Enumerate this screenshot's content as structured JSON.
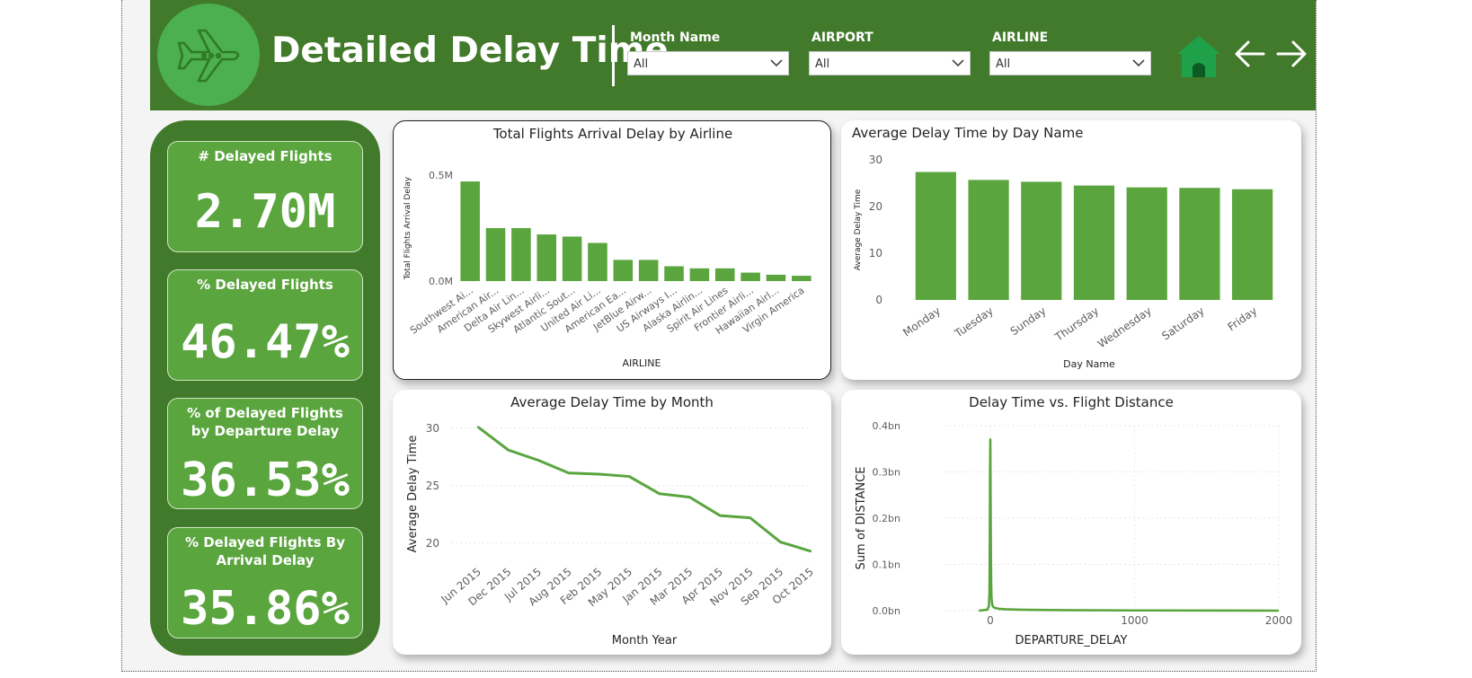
{
  "header": {
    "title": "Detailed Delay Time",
    "logo_icon": "airplane-icon",
    "filters": [
      {
        "label": "Month Name",
        "value": "All"
      },
      {
        "label": "AIRPORT",
        "value": "All"
      },
      {
        "label": "AIRLINE",
        "value": "All"
      }
    ],
    "nav_icons": [
      "home-icon",
      "arrow-left-icon",
      "arrow-right-icon"
    ]
  },
  "kpis": [
    {
      "label": "# Delayed Flights",
      "value": "2.70M"
    },
    {
      "label": "% Delayed Flights",
      "value": "46.47%"
    },
    {
      "label": "% of Delayed Flights by Departure Delay",
      "value": "36.53%"
    },
    {
      "label": "% Delayed Flights By Arrival Delay",
      "value": "35.86%"
    }
  ],
  "colors": {
    "header": "#427a2c",
    "bar": "#5aa53e",
    "accent": "#4caf50",
    "home": "#1fa14a"
  },
  "chart_data": [
    {
      "type": "bar",
      "title": "Total Flights Arrival Delay by Airline",
      "xlabel": "AIRLINE",
      "ylabel": "Total Flights Arrival Delay",
      "yticks": [
        "0.0M",
        "0.5M"
      ],
      "ylim": [
        0,
        0.5
      ],
      "categories": [
        "Southwest Ai...",
        "American Air...",
        "Delta Air Lin...",
        "Skywest Airli...",
        "Atlantic Sout...",
        "United Air Li...",
        "American Ea...",
        "JetBlue Airw...",
        "US Airways I...",
        "Alaska Airlin...",
        "Spirit Air Lines",
        "Frontier Airli...",
        "Hawaiian Airl...",
        "Virgin America"
      ],
      "values": [
        0.47,
        0.25,
        0.25,
        0.22,
        0.21,
        0.18,
        0.1,
        0.1,
        0.07,
        0.06,
        0.06,
        0.04,
        0.03,
        0.025
      ]
    },
    {
      "type": "bar",
      "title": "Average Delay Time by Day Name",
      "xlabel": "Day Name",
      "ylabel": "Average Delay Time",
      "yticks": [
        "0",
        "10",
        "20",
        "30"
      ],
      "ylim": [
        0,
        30
      ],
      "categories": [
        "Monday",
        "Tuesday",
        "Sunday",
        "Thursday",
        "Wednesday",
        "Saturday",
        "Friday"
      ],
      "values": [
        27.4,
        25.7,
        25.3,
        24.5,
        24.1,
        24.0,
        23.7
      ]
    },
    {
      "type": "line",
      "title": "Average Delay Time by Month",
      "xlabel": "Month Year",
      "ylabel": "Average Delay Time",
      "yticks": [
        "20",
        "25",
        "30"
      ],
      "ylim": [
        18.5,
        31
      ],
      "categories": [
        "Jun 2015",
        "Dec 2015",
        "Jul 2015",
        "Aug 2015",
        "Feb 2015",
        "May 2015",
        "Jan 2015",
        "Mar 2015",
        "Apr 2015",
        "Nov 2015",
        "Sep 2015",
        "Oct 2015"
      ],
      "values": [
        30.1,
        28.1,
        27.2,
        26.1,
        26.0,
        25.8,
        24.3,
        24.0,
        22.4,
        22.2,
        20.1,
        19.3
      ]
    },
    {
      "type": "line",
      "title": "Delay Time vs. Flight Distance",
      "xlabel": "DEPARTURE_DELAY",
      "ylabel": "Sum of DISTANCE",
      "xticks": [
        "0",
        "1000",
        "2000"
      ],
      "yticks": [
        "0.0bn",
        "0.1bn",
        "0.2bn",
        "0.3bn",
        "0.4bn"
      ],
      "xlim": [
        -80,
        2000
      ],
      "ylim": [
        0,
        0.4
      ],
      "x": [
        -80,
        -20,
        -10,
        -6,
        -4,
        -2,
        0,
        2,
        4,
        6,
        8,
        12,
        18,
        30,
        60,
        100,
        200,
        500,
        1000,
        2000
      ],
      "y": [
        0,
        0.002,
        0.01,
        0.04,
        0.12,
        0.3,
        0.37,
        0.25,
        0.12,
        0.06,
        0.03,
        0.015,
        0.009,
        0.006,
        0.004,
        0.003,
        0.002,
        0.001,
        0.0005,
        0
      ]
    }
  ]
}
